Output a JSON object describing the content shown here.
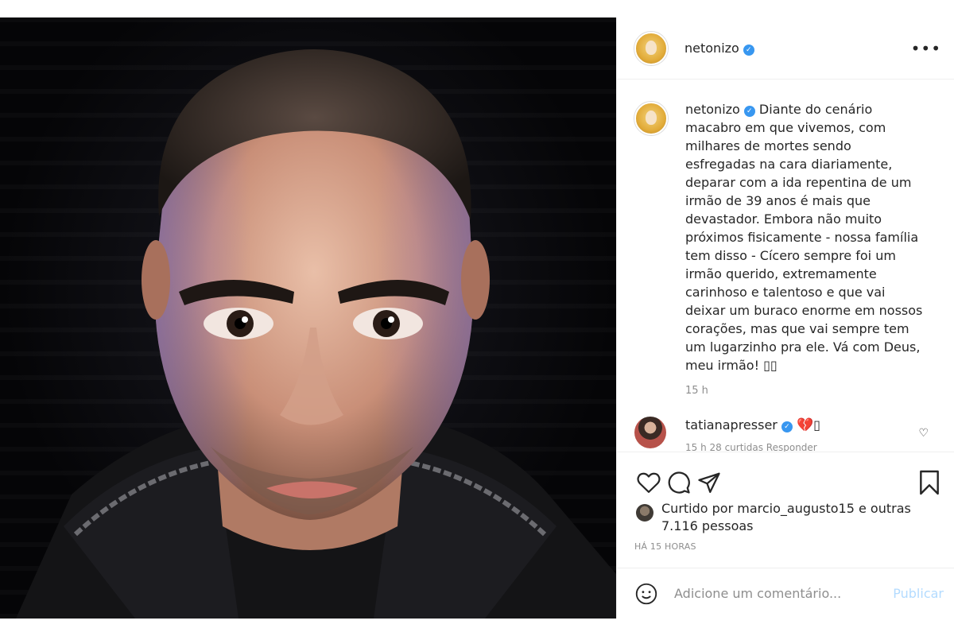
{
  "post": {
    "author": "netonizo",
    "verified": true,
    "more_label": "•••",
    "photo_alt": "Retrato de homem em fundo escuro",
    "caption": {
      "username": "netonizo",
      "text": "Diante do cenário macabro em que vivemos, com milhares de mortes sendo esfregadas na cara diariamente, deparar com a ida repentina de um irmão de 39 anos é mais que devastador. Embora não muito próximos fisicamente - nossa família tem disso - Cícero sempre foi um irmão querido, extremamente carinhoso e talentoso e que vai deixar um buraco enorme em nossos corações, mas que vai sempre tem um lugarzinho pra ele. Vá com Deus, meu irmão! ▯▯",
      "time": "15 h"
    },
    "comments": [
      {
        "username": "tatianapresser",
        "verified": true,
        "emoji": "💔",
        "trailing": "▯",
        "meta": "15 h   28 curtidas   Responder"
      }
    ],
    "likes": {
      "text": "Curtido por marcio_augusto15 e outras 7.116 pessoas"
    },
    "date": "HÁ 15 HORAS",
    "add_comment": {
      "placeholder": "Adicione um comentário...",
      "publish_label": "Publicar"
    }
  },
  "icons": {
    "like": "heart-outline-icon",
    "comment": "comment-bubble-icon",
    "share": "paper-plane-icon",
    "save": "bookmark-icon",
    "emoji": "smiley-icon"
  },
  "colors": {
    "verified": "#3897f0",
    "muted": "#8e8e8e",
    "publish_disabled": "#b3dbff",
    "text": "#262626"
  }
}
